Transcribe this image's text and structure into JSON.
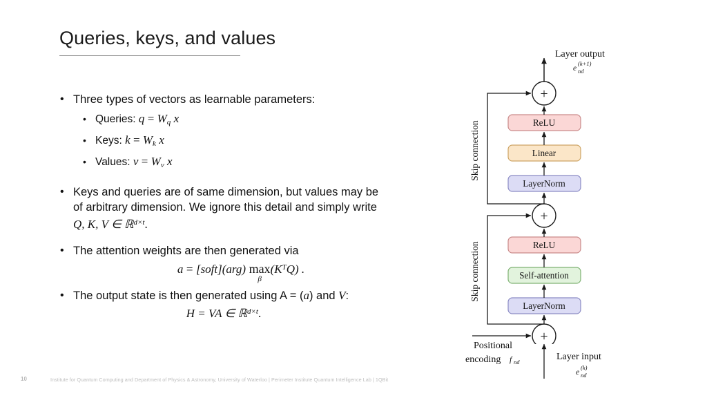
{
  "slide": {
    "title": "Queries, keys, and values",
    "page_number": "10",
    "footer": "Institute for Quantum Computing and Department of Physics & Astronomy, University of Waterloo | Perimeter Institute Quantum Intelligence Lab | 1QBit"
  },
  "bullets": {
    "b1": "Three types of vectors as learnable parameters:",
    "sub": [
      {
        "label": "Queries:",
        "eq_lhs": "q",
        "eq_rel": "=",
        "eq_w": "W",
        "eq_sub": "q",
        "eq_x": "x"
      },
      {
        "label": "Keys:",
        "eq_lhs": "k",
        "eq_rel": "=",
        "eq_w": "W",
        "eq_sub": "k",
        "eq_x": "x"
      },
      {
        "label": "Values:",
        "eq_lhs": "v",
        "eq_rel": "=",
        "eq_w": "W",
        "eq_sub": "v",
        "eq_x": "x"
      }
    ],
    "b2_line1": "Keys and queries are of same dimension, but values may be",
    "b2_line2": "of arbitrary dimension. We ignore this detail and simply write",
    "b2_math": "Q, K, V ∈ ℝ",
    "b2_math_sup": "d×t",
    "b2_math_end": ".",
    "b3": "The attention weights are then generated via",
    "b3_eq": {
      "lhs": "a",
      "rel": "=",
      "soft": "[soft](arg)",
      "max": "max",
      "beta": "β",
      "arg": "(K",
      "arg_sup": "T",
      "arg_end": "Q) ."
    },
    "b4_pre": "The output state is then generated using A = (",
    "b4_a": "a",
    "b4_mid": ") and ",
    "b4_V": "V",
    "b4_colon": ":",
    "b4_eq": {
      "lhs": "H = VA ∈ ℝ",
      "sup": "d×t",
      "end": "."
    }
  },
  "diagram": {
    "top_label_line1": "Layer output",
    "top_label_sym": "e",
    "top_label_sub": "nd",
    "top_label_sup": "(k+1)",
    "bottom_label_line1": "Layer input",
    "bottom_label_sym": "e",
    "bottom_label_sub": "nd",
    "bottom_label_sup": "(k)",
    "positional_line1": "Positional",
    "positional_line2": "encoding",
    "positional_sym": "f",
    "positional_sub": "nd",
    "skip_label_top": "Skip connection",
    "skip_label_bottom": "Skip connection",
    "plus_symbol": "+",
    "blocks_top": [
      {
        "name": "relu",
        "label": "ReLU",
        "fill": "#fbd7d6",
        "stroke": "#c98a8a"
      },
      {
        "name": "linear",
        "label": "Linear",
        "fill": "#fbe6c8",
        "stroke": "#cda465"
      },
      {
        "name": "layernorm",
        "label": "LayerNorm",
        "fill": "#dcdcf5",
        "stroke": "#8b8bc4"
      }
    ],
    "blocks_bottom": [
      {
        "name": "relu",
        "label": "ReLU",
        "fill": "#fbd7d6",
        "stroke": "#c98a8a"
      },
      {
        "name": "self-attention",
        "label": "Self-attention",
        "fill": "#e2f3dd",
        "stroke": "#7fb273"
      },
      {
        "name": "layernorm",
        "label": "LayerNorm",
        "fill": "#dcdcf5",
        "stroke": "#8b8bc4"
      }
    ]
  }
}
